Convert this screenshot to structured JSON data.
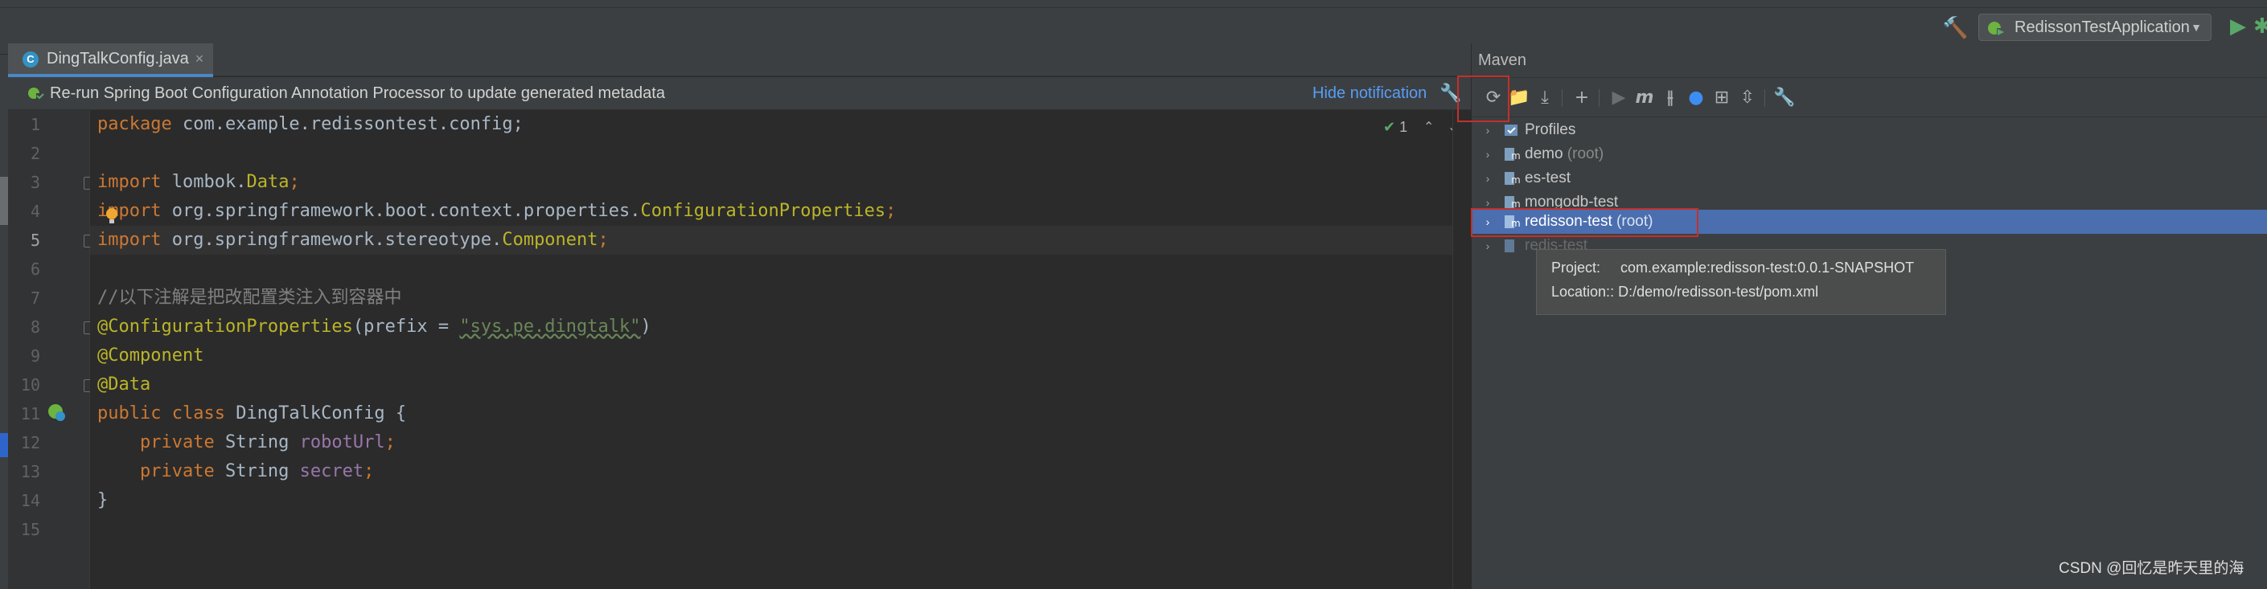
{
  "toolbar": {
    "run_config_label": "RedissonTestApplication",
    "build_icon": "hammer-icon",
    "run_icon": "play-icon",
    "debug_icon": "bug-icon"
  },
  "editor_tabs": [
    {
      "label": "DingTalkConfig.java",
      "icon": "java-class-icon",
      "active": true
    }
  ],
  "notification": {
    "text": "Re-run Spring Boot Configuration Annotation Processor to update generated metadata",
    "action_label": "Hide notification"
  },
  "editor": {
    "line_numbers": [
      "1",
      "2",
      "3",
      "4",
      "5",
      "6",
      "7",
      "8",
      "9",
      "10",
      "11",
      "12",
      "13",
      "14",
      "15"
    ],
    "inspection_count": "1",
    "code": {
      "l1_kw": "package",
      "l1_rest": " com.example.redissontest.config;",
      "l3_kw": "import",
      "l3_a": " lombok.",
      "l3_b": "Data",
      "l3_c": ";",
      "l4_kw": "import",
      "l4_a": " org.springframework.boot.context.properties.",
      "l4_b": "ConfigurationProperties",
      "l4_c": ";",
      "l5_kw": "import",
      "l5_a": " org.springframework.stereotype.",
      "l5_b": "Component",
      "l5_c": ";",
      "l7_comment": "//以下注解是把改配置类注入到容器中",
      "l8_ann": "@ConfigurationProperties",
      "l8_a": "(prefix = ",
      "l8_str": "\"sys.pe.dingtalk\"",
      "l8_b": ")",
      "l9_ann": "@Component",
      "l10_ann": "@Data",
      "l11_kw": "public class",
      "l11_rest": " DingTalkConfig {",
      "l12_kw": "    private",
      "l12_a": " String ",
      "l12_field": "robotUrl",
      "l12_b": ";",
      "l13_kw": "    private",
      "l13_a": " String ",
      "l13_field": "secret",
      "l13_b": ";",
      "l14": "}"
    }
  },
  "maven": {
    "title": "Maven",
    "tree": [
      {
        "label": "Profiles",
        "suffix": "",
        "selected": false
      },
      {
        "label": "demo",
        "suffix": " (root)",
        "selected": false
      },
      {
        "label": "es-test",
        "suffix": "",
        "selected": false
      },
      {
        "label": "mongodb-test",
        "suffix": "",
        "selected": false
      },
      {
        "label": "redisson-test",
        "suffix": " (root)",
        "selected": true
      },
      {
        "label": "redis-test",
        "suffix": "",
        "selected": false
      }
    ],
    "tooltip": {
      "project_key": "Project:",
      "project_value": "com.example:redisson-test:0.0.1-SNAPSHOT",
      "location_key": "Location:",
      "location_value": ": D:/demo/redisson-test/pom.xml"
    }
  },
  "watermark": "CSDN @回忆是昨天里的海",
  "colors": {
    "keyword": "#cc7832",
    "annotation": "#bbb529",
    "string": "#6a8759",
    "field": "#9876aa",
    "selection": "#4b6eaf",
    "highlight_box": "#c4302b"
  }
}
